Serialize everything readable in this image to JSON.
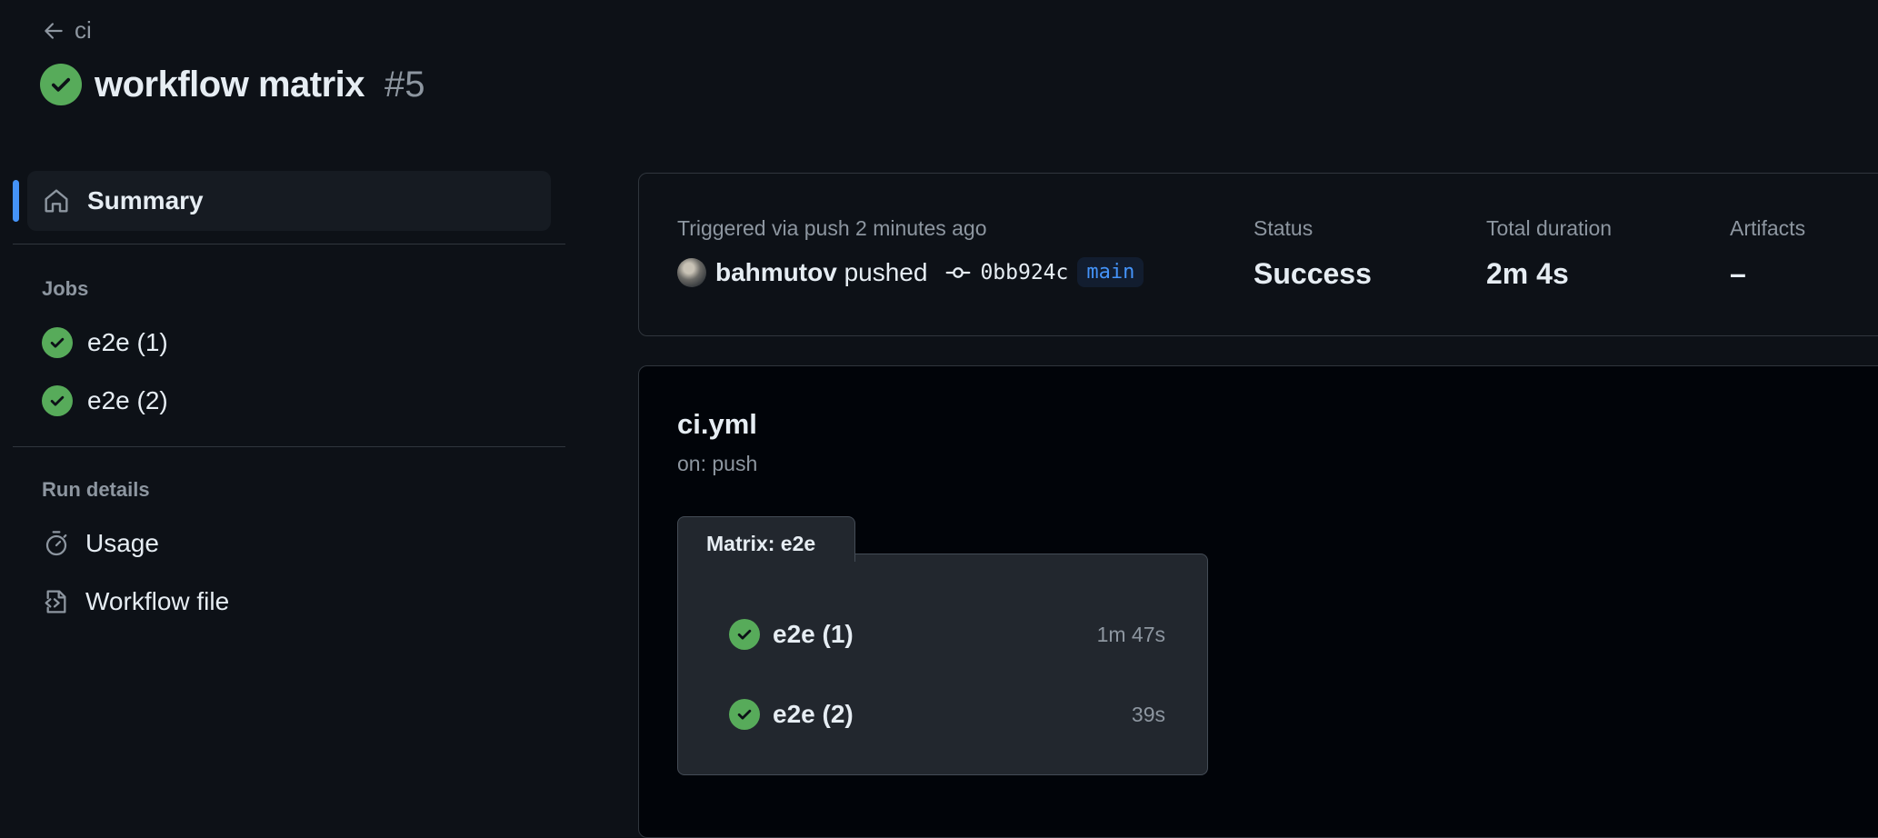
{
  "header": {
    "back_label": "ci",
    "title": "workflow matrix",
    "run_number": "#5",
    "status_color": "#57ab5a"
  },
  "sidebar": {
    "summary_label": "Summary",
    "jobs_title": "Jobs",
    "jobs": [
      {
        "label": "e2e (1)",
        "icon": "check-circle-icon"
      },
      {
        "label": "e2e (2)",
        "icon": "check-circle-icon"
      }
    ],
    "run_details_title": "Run details",
    "details": [
      {
        "label": "Usage",
        "icon": "stopwatch-icon"
      },
      {
        "label": "Workflow file",
        "icon": "file-code-icon"
      }
    ]
  },
  "summary_card": {
    "trigger_text": "Triggered via push 2 minutes ago",
    "pusher": "bahmutov",
    "pushed_word": "pushed",
    "commit_sha": "0bb924c",
    "branch": "main",
    "status_label": "Status",
    "status_value": "Success",
    "duration_label": "Total duration",
    "duration_value": "2m 4s",
    "artifacts_label": "Artifacts",
    "artifacts_value": "–"
  },
  "workflow_graph": {
    "file_name": "ci.yml",
    "trigger": "on: push",
    "matrix_label": "Matrix: e2e",
    "jobs": [
      {
        "name": "e2e (1)",
        "duration": "1m 47s"
      },
      {
        "name": "e2e (2)",
        "duration": "39s"
      }
    ]
  },
  "colors": {
    "background": "#0d1117",
    "accent_blue": "#4493f8",
    "success_green": "#57ab5a"
  }
}
